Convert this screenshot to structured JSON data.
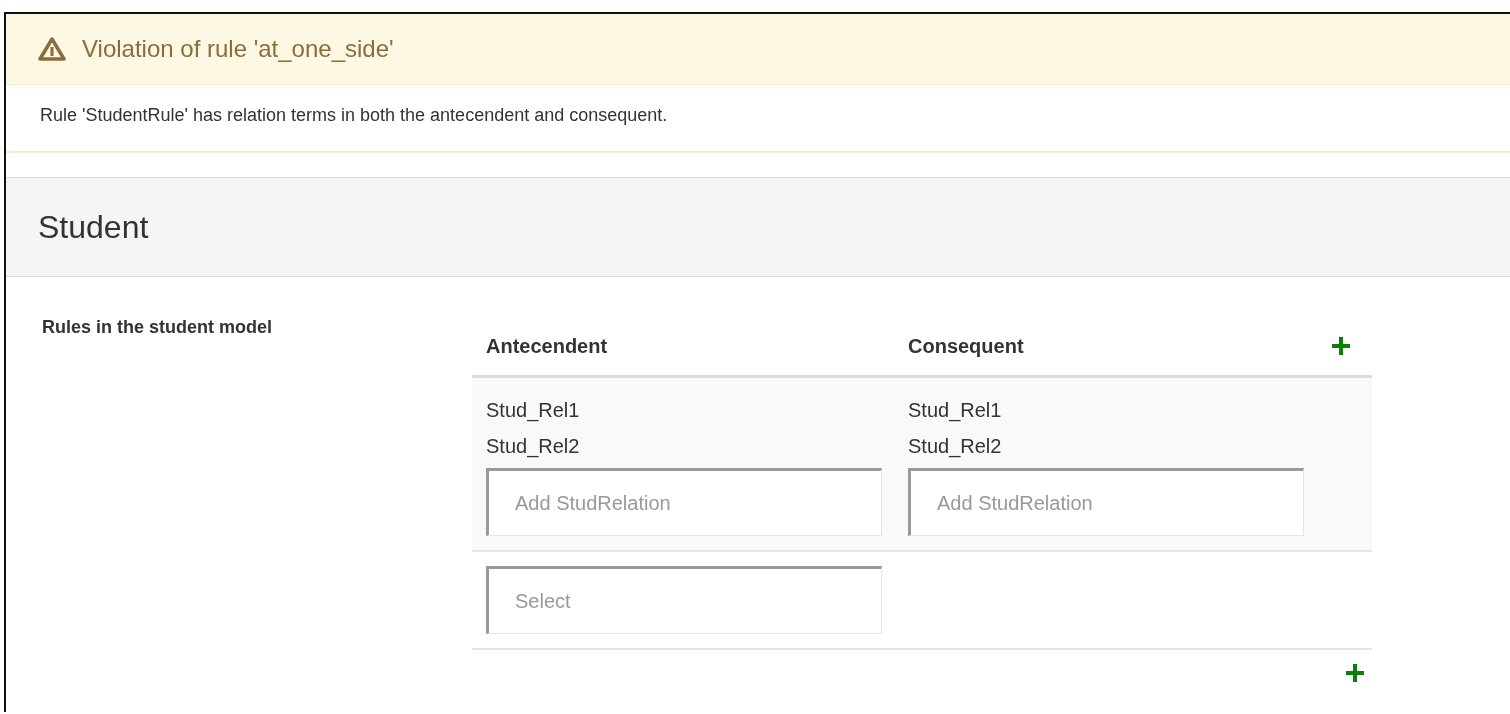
{
  "alert": {
    "title": "Violation of rule 'at_one_side'",
    "message": "Rule 'StudentRule' has relation terms in both the antecendent and consequent."
  },
  "panel": {
    "title": "Student"
  },
  "rules": {
    "label": "Rules in the student model",
    "columns": [
      "Antecendent",
      "Consequent"
    ],
    "rows": [
      {
        "antecedent": [
          "Stud_Rel1",
          "Stud_Rel2"
        ],
        "antecedent_placeholder": "Add StudRelation",
        "consequent": [
          "Stud_Rel1",
          "Stud_Rel2"
        ],
        "consequent_placeholder": "Add StudRelation"
      }
    ],
    "select_placeholder": "Select"
  }
}
